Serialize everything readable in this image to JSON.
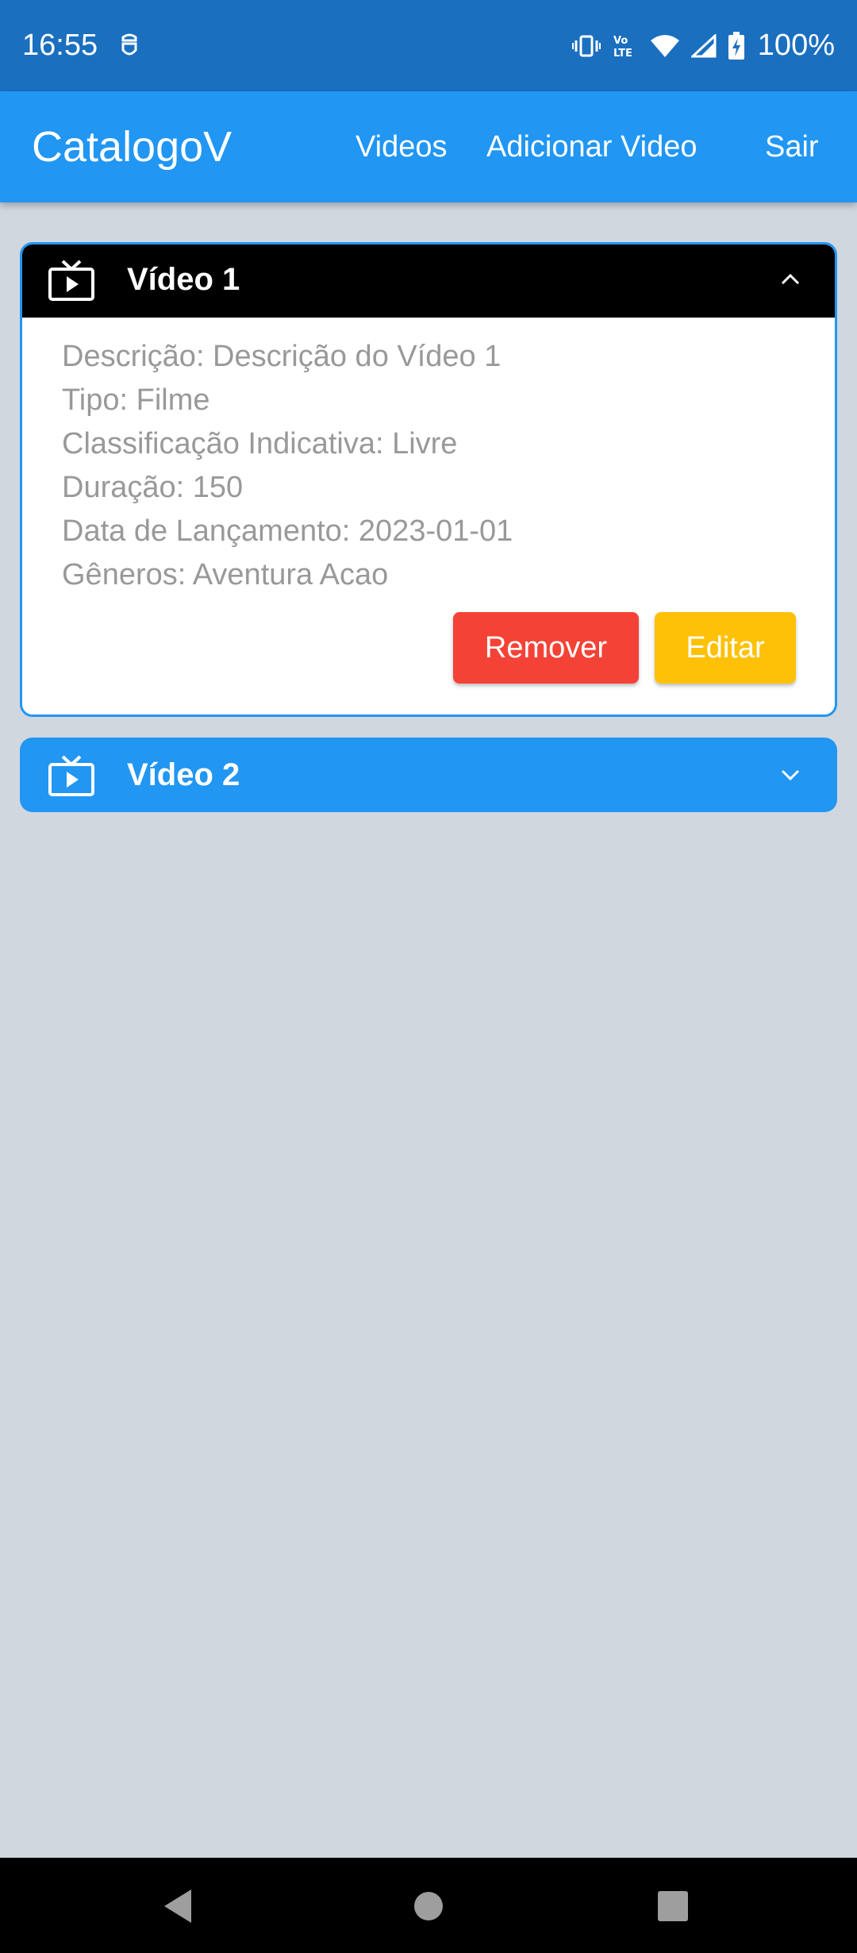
{
  "status_bar": {
    "time": "16:55",
    "battery": "100%",
    "icons": [
      "notification-icon",
      "vibrate-icon",
      "volte-icon",
      "wifi-icon",
      "signal-icon",
      "battery-icon"
    ]
  },
  "app_bar": {
    "title": "CatalogoV",
    "links": {
      "videos": "Videos",
      "add_video": "Adicionar Video",
      "logout": "Sair"
    }
  },
  "videos": [
    {
      "title": "Vídeo 1",
      "expanded": true,
      "details": {
        "descricao": "Descrição: Descrição do Vídeo 1",
        "tipo": "Tipo: Filme",
        "classificacao": "Classificação Indicativa: Livre",
        "duracao": "Duração: 150",
        "data": "Data de Lançamento: 2023-01-01",
        "generos": "Gêneros:  Aventura Acao"
      },
      "remove_label": "Remover",
      "edit_label": "Editar"
    },
    {
      "title": "Vídeo 2",
      "expanded": false
    }
  ],
  "colors": {
    "status_bar": "#1a6fbf",
    "app_bar": "#2196f3",
    "background": "#d0d7df",
    "remove": "#f44336",
    "edit": "#ffc107"
  }
}
